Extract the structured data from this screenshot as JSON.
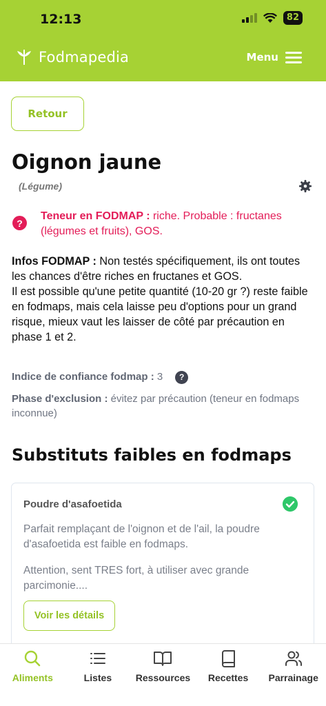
{
  "status_bar": {
    "time": "12:13",
    "battery": "82"
  },
  "header": {
    "app_name": "Fodmapedia",
    "menu_label": "Menu"
  },
  "back_button": "Retour",
  "food": {
    "name": "Oignon jaune",
    "category": "(Légume)",
    "teneur_label": "Teneur en FODMAP :",
    "teneur_value": " riche. Probable : fructanes (légumes et fruits), GOS.",
    "infos_label": "Infos FODMAP :",
    "infos_text_1": " Non testés spécifiquement, ils ont toutes les chances d'être riches en fructanes et GOS.",
    "infos_text_2": "Il est possible qu'une petite quantité (10-20 gr ?) reste faible en fodmaps, mais cela laisse peu d'options pour un grand risque, mieux vaut les laisser de côté par précaution en phase 1 et 2.",
    "confidence_label": "Indice de confiance fodmap :",
    "confidence_value": " 3",
    "exclusion_label": "Phase d'exclusion :",
    "exclusion_value": " évitez par précaution (teneur en fodmaps inconnue)"
  },
  "substitutes": {
    "title": "Substituts faibles en fodmaps",
    "items": [
      {
        "name": "Poudre d'asafoetida",
        "text_1": "Parfait remplaçant de l'oignon et de l'ail, la poudre d'asafoetida est faible en fodmaps.",
        "text_2": "Attention, sent TRES fort, à utiliser avec grande parcimonie....",
        "button": "Voir les détails"
      }
    ]
  },
  "tabs": [
    {
      "label": "Aliments",
      "icon": "search-icon",
      "active": true
    },
    {
      "label": "Listes",
      "icon": "list-icon",
      "active": false
    },
    {
      "label": "Ressources",
      "icon": "book-open-icon",
      "active": false
    },
    {
      "label": "Recettes",
      "icon": "book-icon",
      "active": false
    },
    {
      "label": "Parrainage",
      "icon": "users-icon",
      "active": false
    }
  ],
  "colors": {
    "brand_green": "#a6d234",
    "alert_red": "#e31d58",
    "check_green": "#2ec769"
  }
}
